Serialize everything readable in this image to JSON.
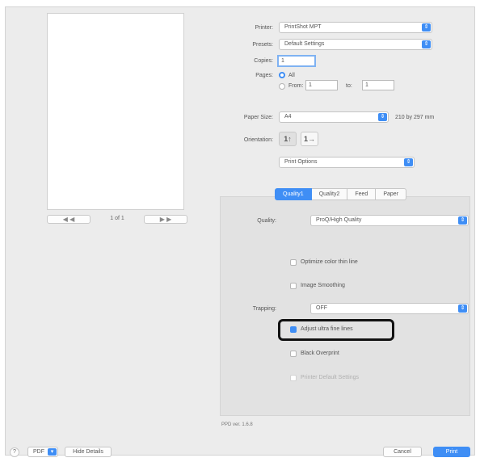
{
  "preview": {
    "page_counter": "1 of 1",
    "prev_label": "◀  ◀",
    "next_label": "▶  ▶"
  },
  "printer": {
    "label": "Printer:",
    "value": "PrintShot MPT"
  },
  "presets": {
    "label": "Presets:",
    "value": "Default Settings"
  },
  "copies": {
    "label": "Copies:",
    "value": "1"
  },
  "pages": {
    "label": "Pages:",
    "all_label": "All",
    "from_label": "From:",
    "from_value": "1",
    "to_label": "to:",
    "to_value": "1"
  },
  "paper_size": {
    "label": "Paper Size:",
    "value": "A4",
    "dimensions": "210 by 297 mm"
  },
  "orientation": {
    "label": "Orientation:",
    "portrait_glyph": "1↑",
    "landscape_glyph": "1→"
  },
  "section_popup": {
    "value": "Print Options"
  },
  "tabs": [
    {
      "label": "Quality1"
    },
    {
      "label": "Quality2"
    },
    {
      "label": "Feed"
    },
    {
      "label": "Paper"
    }
  ],
  "options": {
    "quality_label": "Quality:",
    "quality_value": "ProQ/High Quality",
    "optimize_label": "Optimize color thin line",
    "smoothing_label": "Image Smoothing",
    "trapping_label": "Trapping:",
    "trapping_value": "OFF",
    "adjust_label": "Adjust ultra fine lines",
    "black_label": "Black Overprint",
    "printer_label": "Printer Default Settings"
  },
  "footer_info": "PPD ver. 1.6.8",
  "footer": {
    "help": "?",
    "pdf_label": "PDF",
    "hide_details": "Hide Details",
    "cancel": "Cancel",
    "print": "Print"
  },
  "icons": {
    "popup": "chevron-updown-icon"
  },
  "colors": {
    "accent": "#3f8ef5",
    "highlight": "#111111"
  }
}
